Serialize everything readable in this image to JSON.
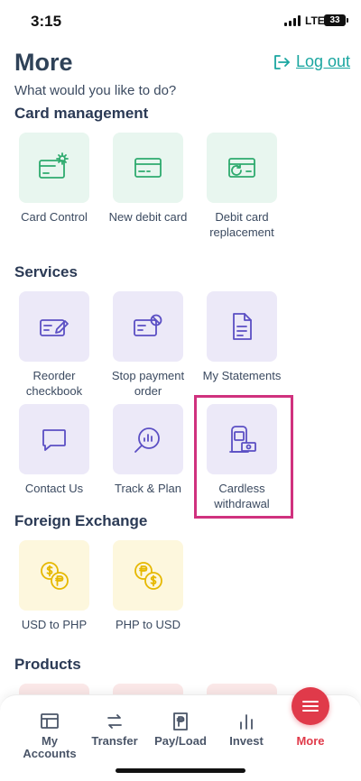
{
  "status_bar": {
    "time": "3:15",
    "network": "LTE",
    "battery": "33"
  },
  "header": {
    "title": "More",
    "logout_label": "Log out",
    "subtitle": "What would you like to do?"
  },
  "sections": {
    "card_management": {
      "title": "Card management",
      "items": [
        {
          "label": "Card Control",
          "icon": "card-gear-icon"
        },
        {
          "label": "New debit card",
          "icon": "credit-card-icon"
        },
        {
          "label": "Debit card replacement",
          "icon": "card-refresh-icon"
        }
      ]
    },
    "services": {
      "title": "Services",
      "items": [
        {
          "label": "Reorder checkbook",
          "icon": "checkbook-pen-icon"
        },
        {
          "label": "Stop payment order",
          "icon": "stop-payment-icon"
        },
        {
          "label": "My Statements",
          "icon": "document-icon"
        },
        {
          "label": "Contact Us",
          "icon": "chat-bubble-icon"
        },
        {
          "label": "Track & Plan",
          "icon": "chart-magnifier-icon"
        },
        {
          "label": "Cardless withdrawal",
          "icon": "atm-cash-icon"
        }
      ]
    },
    "foreign_exchange": {
      "title": "Foreign Exchange",
      "items": [
        {
          "label": "USD to PHP",
          "icon": "usd-php-coins-icon"
        },
        {
          "label": "PHP to USD",
          "icon": "php-usd-coins-icon"
        }
      ]
    },
    "products": {
      "title": "Products"
    }
  },
  "bottom_nav": [
    {
      "label": "My Accounts",
      "icon": "accounts-icon"
    },
    {
      "label": "Transfer",
      "icon": "transfer-arrows-icon"
    },
    {
      "label": "Pay/Load",
      "icon": "peso-bill-icon"
    },
    {
      "label": "Invest",
      "icon": "bar-chart-icon"
    },
    {
      "label": "More",
      "icon": "menu-icon",
      "active": true
    }
  ],
  "colors": {
    "accent_teal": "#1aa6a0",
    "active_red": "#e03a4a",
    "highlight_pink": "#d0317e",
    "green_tile": "#e8f6ef",
    "purple_tile": "#ece9f8",
    "yellow_tile": "#fdf7dd"
  }
}
